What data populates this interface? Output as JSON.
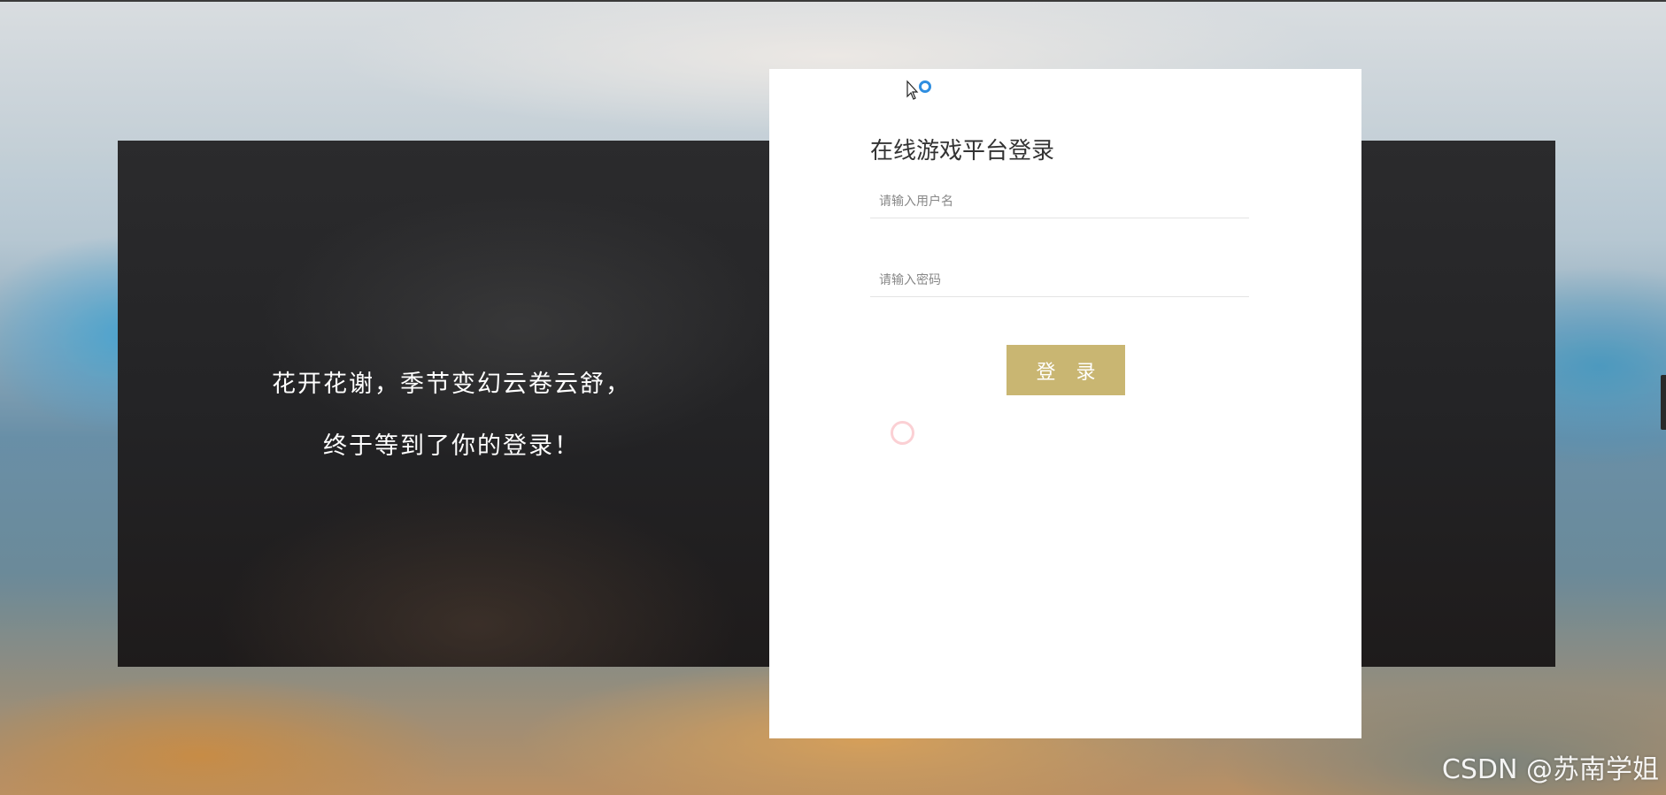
{
  "hero": {
    "line1": "花开花谢，季节变幻云卷云舒，",
    "line2": "终于等到了你的登录！"
  },
  "login": {
    "title": "在线游戏平台登录",
    "username_placeholder": "请输入用户名",
    "username_value": "",
    "password_placeholder": "请输入密码",
    "password_value": "",
    "submit_label": "登 录"
  },
  "watermark": "CSDN @苏南学姐",
  "colors": {
    "button": "#c9b672",
    "card": "#ffffff",
    "panel": "#252527"
  },
  "icons": {
    "cursor": "busy-cursor-icon",
    "ring": "click-ripple-icon"
  }
}
